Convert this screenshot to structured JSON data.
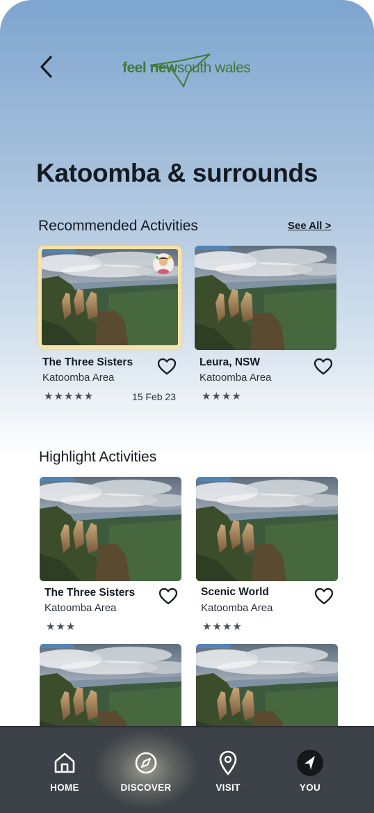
{
  "header": {
    "back_icon": "chevron-left-icon",
    "logo": {
      "feel": "feel",
      "new": "new",
      "rest": "south wales"
    }
  },
  "page": {
    "title": "Katoomba & surrounds"
  },
  "recommended": {
    "title": "Recommended Activities",
    "see_all": "See All >",
    "cards": [
      {
        "name": "The Three Sisters",
        "area": "Katoomba Area",
        "stars": "★★★★★",
        "rating": 5,
        "date": "15 Feb 23",
        "selected": true
      },
      {
        "name": "Leura, NSW",
        "area": "Katoomba Area",
        "stars": "★★★★",
        "rating": 4
      }
    ]
  },
  "highlight": {
    "title": "Highlight Activities",
    "cards": [
      {
        "name": "The Three Sisters",
        "area": "Katoomba Area",
        "stars": "★★★",
        "rating": 3
      },
      {
        "name": "Scenic World",
        "area": "Katoomba Area",
        "stars": "★★★★",
        "rating": 4
      }
    ]
  },
  "nav": {
    "items": [
      {
        "label": "HOME",
        "icon": "home-icon"
      },
      {
        "label": "DISCOVER",
        "icon": "compass-icon",
        "active": true
      },
      {
        "label": "VISIT",
        "icon": "map-pin-icon"
      },
      {
        "label": "YOU",
        "icon": "navigation-arrow-icon"
      }
    ]
  },
  "colors": {
    "nav_bg": "#3d4148",
    "logo_green": "#3e7a3a",
    "selected_border": "#f8e4a8"
  }
}
